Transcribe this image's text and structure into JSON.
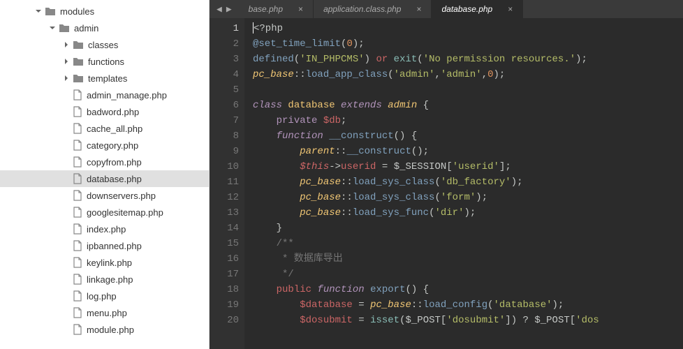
{
  "sidebar": {
    "root": {
      "label": "modules",
      "type": "folder",
      "expanded": true,
      "indent": 50,
      "children": [
        {
          "label": "admin",
          "type": "folder",
          "expanded": true,
          "indent": 70,
          "children": [
            {
              "label": "classes",
              "type": "folder",
              "expanded": false,
              "indent": 90
            },
            {
              "label": "functions",
              "type": "folder",
              "expanded": false,
              "indent": 90
            },
            {
              "label": "templates",
              "type": "folder",
              "expanded": false,
              "indent": 90
            },
            {
              "label": "admin_manage.php",
              "type": "file",
              "indent": 90
            },
            {
              "label": "badword.php",
              "type": "file",
              "indent": 90
            },
            {
              "label": "cache_all.php",
              "type": "file",
              "indent": 90
            },
            {
              "label": "category.php",
              "type": "file",
              "indent": 90
            },
            {
              "label": "copyfrom.php",
              "type": "file",
              "indent": 90
            },
            {
              "label": "database.php",
              "type": "file",
              "indent": 90,
              "selected": true
            },
            {
              "label": "downservers.php",
              "type": "file",
              "indent": 90
            },
            {
              "label": "googlesitemap.php",
              "type": "file",
              "indent": 90
            },
            {
              "label": "index.php",
              "type": "file",
              "indent": 90
            },
            {
              "label": "ipbanned.php",
              "type": "file",
              "indent": 90
            },
            {
              "label": "keylink.php",
              "type": "file",
              "indent": 90
            },
            {
              "label": "linkage.php",
              "type": "file",
              "indent": 90
            },
            {
              "label": "log.php",
              "type": "file",
              "indent": 90
            },
            {
              "label": "menu.php",
              "type": "file",
              "indent": 90
            },
            {
              "label": "module.php",
              "type": "file",
              "indent": 90
            }
          ]
        }
      ]
    }
  },
  "tabs": [
    {
      "label": "base.php",
      "active": false
    },
    {
      "label": "application.class.php",
      "active": false
    },
    {
      "label": "database.php",
      "active": true
    }
  ],
  "code": {
    "lines": [
      [
        {
          "t": "<",
          "c": "default"
        },
        {
          "t": "?php",
          "c": "default"
        }
      ],
      [
        {
          "t": "@set_time_limit",
          "c": "blue"
        },
        {
          "t": "(",
          "c": "default"
        },
        {
          "t": "0",
          "c": "orange"
        },
        {
          "t": ");",
          "c": "default"
        }
      ],
      [
        {
          "t": "defined",
          "c": "blue"
        },
        {
          "t": "(",
          "c": "default"
        },
        {
          "t": "'IN_PHPCMS'",
          "c": "green"
        },
        {
          "t": ") ",
          "c": "default"
        },
        {
          "t": "or",
          "c": "red"
        },
        {
          "t": " ",
          "c": "default"
        },
        {
          "t": "exit",
          "c": "cyan"
        },
        {
          "t": "(",
          "c": "default"
        },
        {
          "t": "'No permission resources.'",
          "c": "green"
        },
        {
          "t": ");",
          "c": "default"
        }
      ],
      [
        {
          "t": "pc_base",
          "c": "yellow",
          "i": true
        },
        {
          "t": "::",
          "c": "default"
        },
        {
          "t": "load_app_class",
          "c": "blue"
        },
        {
          "t": "(",
          "c": "default"
        },
        {
          "t": "'admin'",
          "c": "green"
        },
        {
          "t": ",",
          "c": "default"
        },
        {
          "t": "'admin'",
          "c": "green"
        },
        {
          "t": ",",
          "c": "default"
        },
        {
          "t": "0",
          "c": "orange"
        },
        {
          "t": ");",
          "c": "default"
        }
      ],
      [],
      [
        {
          "t": "class",
          "c": "purple",
          "i": true
        },
        {
          "t": " ",
          "c": "default"
        },
        {
          "t": "database",
          "c": "yellow"
        },
        {
          "t": " ",
          "c": "default"
        },
        {
          "t": "extends",
          "c": "purple",
          "i": true
        },
        {
          "t": " ",
          "c": "default"
        },
        {
          "t": "admin",
          "c": "yellow",
          "i": true
        },
        {
          "t": " {",
          "c": "default"
        }
      ],
      [
        {
          "t": "    ",
          "c": "default"
        },
        {
          "t": "private",
          "c": "purple"
        },
        {
          "t": " ",
          "c": "default"
        },
        {
          "t": "$db",
          "c": "red"
        },
        {
          "t": ";",
          "c": "default"
        }
      ],
      [
        {
          "t": "    ",
          "c": "default"
        },
        {
          "t": "function",
          "c": "purple",
          "i": true
        },
        {
          "t": " ",
          "c": "default"
        },
        {
          "t": "__construct",
          "c": "blue"
        },
        {
          "t": "() {",
          "c": "default"
        }
      ],
      [
        {
          "t": "        ",
          "c": "default"
        },
        {
          "t": "parent",
          "c": "yellow",
          "i": true
        },
        {
          "t": "::",
          "c": "default"
        },
        {
          "t": "__construct",
          "c": "blue"
        },
        {
          "t": "();",
          "c": "default"
        }
      ],
      [
        {
          "t": "        ",
          "c": "default"
        },
        {
          "t": "$this",
          "c": "red",
          "i": true
        },
        {
          "t": "->",
          "c": "default"
        },
        {
          "t": "userid",
          "c": "red"
        },
        {
          "t": " = ",
          "c": "default"
        },
        {
          "t": "$_SESSION",
          "c": "default"
        },
        {
          "t": "[",
          "c": "default"
        },
        {
          "t": "'userid'",
          "c": "green"
        },
        {
          "t": "];",
          "c": "default"
        }
      ],
      [
        {
          "t": "        ",
          "c": "default"
        },
        {
          "t": "pc_base",
          "c": "yellow",
          "i": true
        },
        {
          "t": "::",
          "c": "default"
        },
        {
          "t": "load_sys_class",
          "c": "blue"
        },
        {
          "t": "(",
          "c": "default"
        },
        {
          "t": "'db_factory'",
          "c": "green"
        },
        {
          "t": ");",
          "c": "default"
        }
      ],
      [
        {
          "t": "        ",
          "c": "default"
        },
        {
          "t": "pc_base",
          "c": "yellow",
          "i": true
        },
        {
          "t": "::",
          "c": "default"
        },
        {
          "t": "load_sys_class",
          "c": "blue"
        },
        {
          "t": "(",
          "c": "default"
        },
        {
          "t": "'form'",
          "c": "green"
        },
        {
          "t": ");",
          "c": "default"
        }
      ],
      [
        {
          "t": "        ",
          "c": "default"
        },
        {
          "t": "pc_base",
          "c": "yellow",
          "i": true
        },
        {
          "t": "::",
          "c": "default"
        },
        {
          "t": "load_sys_func",
          "c": "blue"
        },
        {
          "t": "(",
          "c": "default"
        },
        {
          "t": "'dir'",
          "c": "green"
        },
        {
          "t": ");",
          "c": "default"
        }
      ],
      [
        {
          "t": "    }",
          "c": "default"
        }
      ],
      [
        {
          "t": "    ",
          "c": "default"
        },
        {
          "t": "/**",
          "c": "comment"
        }
      ],
      [
        {
          "t": "     * 数据库导出",
          "c": "comment"
        }
      ],
      [
        {
          "t": "     */",
          "c": "comment"
        }
      ],
      [
        {
          "t": "    ",
          "c": "default"
        },
        {
          "t": "public",
          "c": "red"
        },
        {
          "t": " ",
          "c": "default"
        },
        {
          "t": "function",
          "c": "purple",
          "i": true
        },
        {
          "t": " ",
          "c": "default"
        },
        {
          "t": "export",
          "c": "blue"
        },
        {
          "t": "() {",
          "c": "default"
        }
      ],
      [
        {
          "t": "        ",
          "c": "default"
        },
        {
          "t": "$database",
          "c": "red"
        },
        {
          "t": " = ",
          "c": "default"
        },
        {
          "t": "pc_base",
          "c": "yellow",
          "i": true
        },
        {
          "t": "::",
          "c": "default"
        },
        {
          "t": "load_config",
          "c": "blue"
        },
        {
          "t": "(",
          "c": "default"
        },
        {
          "t": "'database'",
          "c": "green"
        },
        {
          "t": ");",
          "c": "default"
        }
      ],
      [
        {
          "t": "        ",
          "c": "default"
        },
        {
          "t": "$dosubmit",
          "c": "red"
        },
        {
          "t": " = ",
          "c": "default"
        },
        {
          "t": "isset",
          "c": "cyan"
        },
        {
          "t": "(",
          "c": "default"
        },
        {
          "t": "$_POST",
          "c": "default"
        },
        {
          "t": "[",
          "c": "default"
        },
        {
          "t": "'dosubmit'",
          "c": "green"
        },
        {
          "t": "]) ? ",
          "c": "default"
        },
        {
          "t": "$_POST",
          "c": "default"
        },
        {
          "t": "[",
          "c": "default"
        },
        {
          "t": "'dos",
          "c": "green"
        }
      ]
    ]
  }
}
